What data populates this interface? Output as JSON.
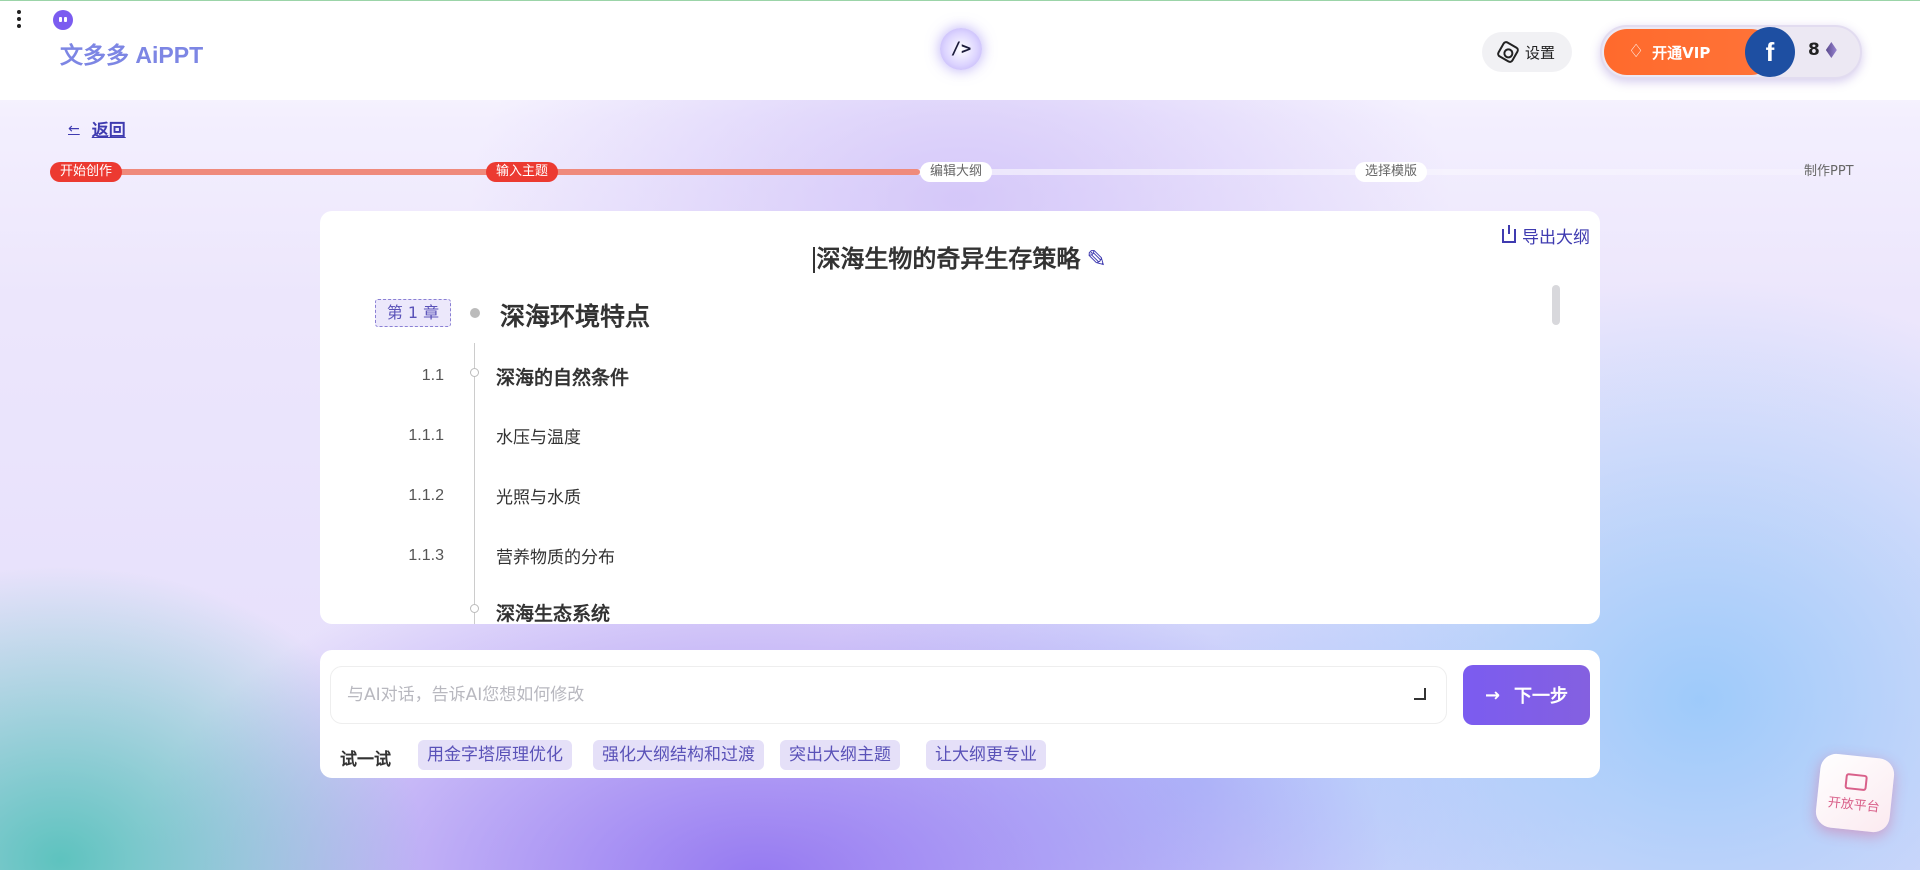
{
  "header": {
    "logo": "文多多 AiPPT",
    "center_logo": "/>",
    "settings_label": "设置",
    "vip_label": "开通VIP",
    "avatar_letter": "f",
    "credits": "8"
  },
  "nav": {
    "back_label": "返回"
  },
  "steps": [
    {
      "label": "开始创作",
      "state": "done"
    },
    {
      "label": "输入主题",
      "state": "done"
    },
    {
      "label": "编辑大纲",
      "state": "todo"
    },
    {
      "label": "选择模版",
      "state": "todo"
    },
    {
      "label": "制作PPT",
      "state": "todo"
    }
  ],
  "outline": {
    "export_label": "导出大纲",
    "title": "深海生物的奇异生存策略",
    "chapter_badge": "第 1 章",
    "chapter_title": "深海环境特点",
    "rows": [
      {
        "num": "1.1",
        "text": "深海的自然条件"
      },
      {
        "num": "1.1.1",
        "text": "水压与温度"
      },
      {
        "num": "1.1.2",
        "text": "光照与水质"
      },
      {
        "num": "1.1.3",
        "text": "营养物质的分布"
      },
      {
        "num": "",
        "text": "深海生态系统"
      }
    ]
  },
  "chat": {
    "placeholder": "与AI对话，告诉AI您想如何修改",
    "next_label": "下一步",
    "try_label": "试一试",
    "chips": [
      "用金字塔原理优化",
      "强化大纲结构和过渡",
      "突出大纲主题",
      "让大纲更专业"
    ]
  },
  "floating": {
    "open_platform_label": "开放平台"
  },
  "colors": {
    "accent": "#7b5cf0",
    "vip": "#ff6a2c",
    "step_done": "#ec3a31",
    "link": "#3f3bb0"
  }
}
